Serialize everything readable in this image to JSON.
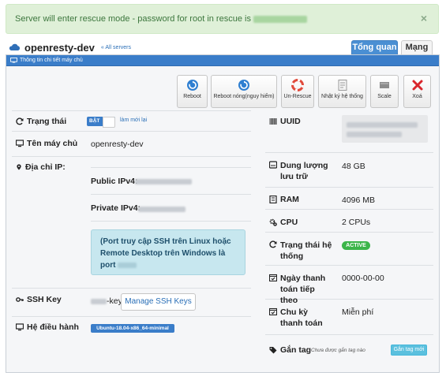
{
  "alert": {
    "message": "Server will enter rescue mode - password for root in rescue is",
    "close_label": "×"
  },
  "server": {
    "name": "openresty-dev",
    "all_servers_link": "« All servers"
  },
  "tabs": [
    {
      "label": "Tổng quan",
      "active": true
    },
    {
      "label": "Mạng",
      "active": false
    }
  ],
  "panel": {
    "title": "Thông tin chi tiết máy chủ"
  },
  "actions": [
    {
      "label": "Reboot",
      "icon": "reboot-icon"
    },
    {
      "label": "Reboot nóng(nguy hiểm)",
      "icon": "hard-reboot-icon"
    },
    {
      "label": "Un-Rescue",
      "icon": "lifebuoy-icon"
    },
    {
      "label": "Nhật ký hệ thống",
      "icon": "log-icon"
    },
    {
      "label": "Scale",
      "icon": "scale-icon"
    },
    {
      "label": "Xoá",
      "icon": "delete-icon"
    }
  ],
  "left": {
    "status_label": "Trạng thái",
    "status_badge": "BẬT",
    "refresh_link": "làm mới lại",
    "hostname_label": "Tên máy chủ",
    "hostname_value": "openresty-dev",
    "ip_label": "Địa chỉ IP:",
    "public_ipv4_label": "Public IPv4:",
    "private_ipv4_label": "Private IPv4:",
    "ssh_note": "(Port truy cập SSH trên Linux hoặc Remote Desktop trên Windows là port",
    "ssh_key_label": "SSH Key",
    "ssh_key_suffix": "-key",
    "manage_ssh_button": "Manage SSH Keys",
    "os_label": "Hệ điều hành",
    "os_value": "Ubuntu-18.04-x86_64-minimal"
  },
  "right": {
    "uuid_label": "UUID",
    "storage_label": "Dung lượng lưu trữ",
    "storage_value": "48 GB",
    "ram_label": "RAM",
    "ram_value": "4096 MB",
    "cpu_label": "CPU",
    "cpu_value": "2 CPUs",
    "sys_status_label": "Trạng thái hệ thống",
    "sys_status_value": "ACTIVE",
    "next_pay_label": "Ngày thanh toán tiếp theo",
    "next_pay_value": "0000-00-00",
    "billing_label": "Chu kỳ thanh toán",
    "billing_value": "Miễn phí",
    "tag_label": "Gắn tag",
    "tag_note": "Chưa được gắn tag nào",
    "tag_button": "Gắn tag mới"
  },
  "colors": {
    "accent": "#3a7dc9",
    "alert_bg": "#dff0d8",
    "active_green": "#3cb54a",
    "info_box": "#c7e7ef",
    "delete_red": "#d9262c"
  }
}
